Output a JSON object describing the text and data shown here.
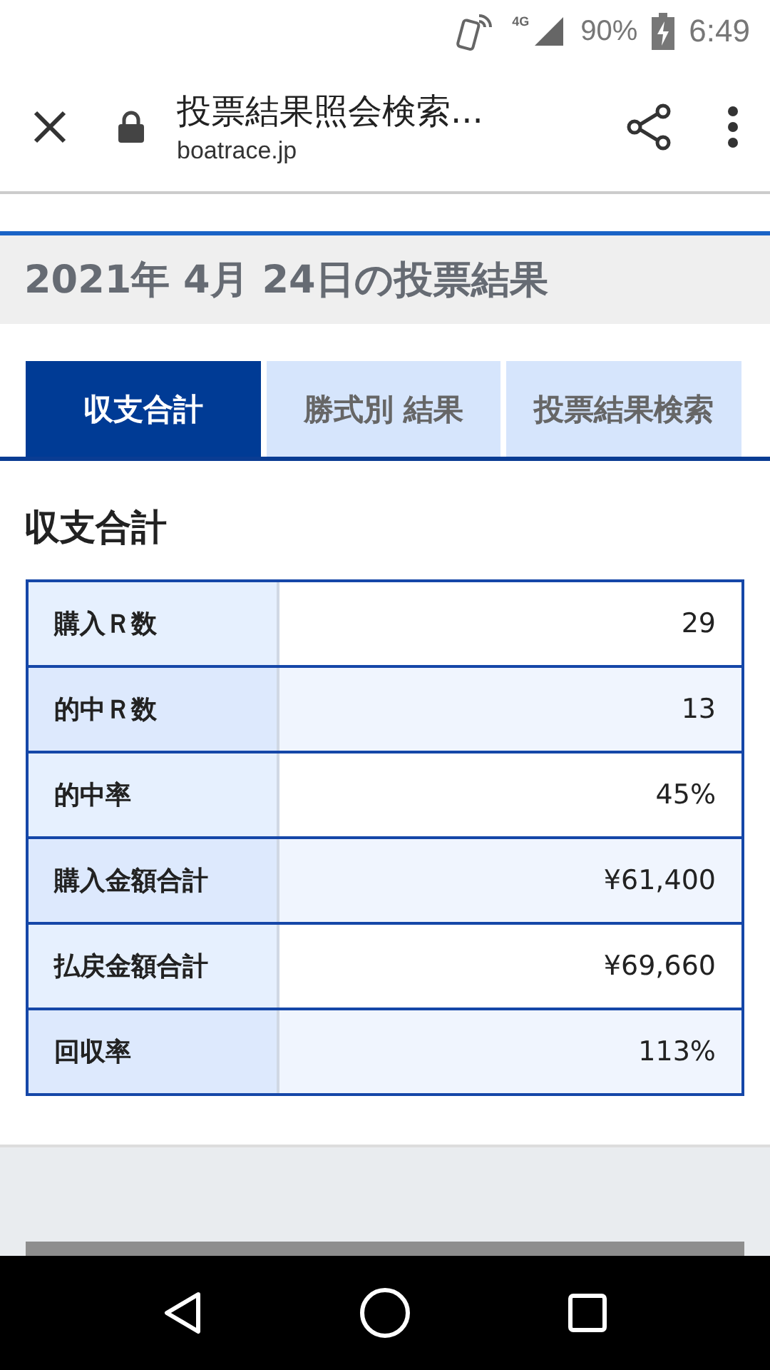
{
  "status_bar": {
    "network": "4G",
    "battery": "90%",
    "time": "6:49"
  },
  "browser": {
    "title": "投票結果照会検索...",
    "url": "boatrace.jp"
  },
  "page_heading": "2021年 4月 24日の投票結果",
  "tabs": [
    {
      "label": "収支合計",
      "selected": true
    },
    {
      "label": "勝式別 結果",
      "selected": false
    },
    {
      "label": "投票結果検索",
      "selected": false
    }
  ],
  "section_title": "収支合計",
  "table": {
    "rows": [
      {
        "label": "購入Ｒ数",
        "value": "29"
      },
      {
        "label": "的中Ｒ数",
        "value": "13"
      },
      {
        "label": "的中率",
        "value": "45%"
      },
      {
        "label": "購入金額合計",
        "value": "¥61,400"
      },
      {
        "label": "払戻金額合計",
        "value": "¥69,660"
      },
      {
        "label": "回収率",
        "value": "113%"
      }
    ]
  }
}
